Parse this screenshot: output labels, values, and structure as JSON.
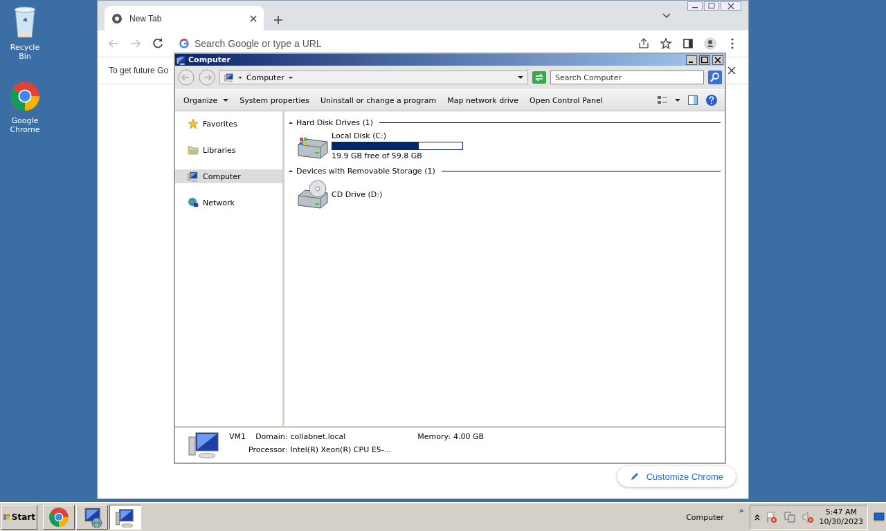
{
  "desktop_icons": [
    {
      "kind": "recycle",
      "label": "Recycle Bin"
    },
    {
      "kind": "chrome",
      "label": "Google Chrome"
    }
  ],
  "browser": {
    "tab_title": "New Tab",
    "address_placeholder": "Search Google or type a URL",
    "infobar_text": "To get future Go",
    "customize_button": "Customize Chrome"
  },
  "explorer": {
    "title": "Computer",
    "breadcrumb": "Computer",
    "search_placeholder": "Search Computer",
    "toolbar": [
      {
        "label": "Organize",
        "kind": "menu"
      },
      {
        "label": "System properties",
        "kind": "action"
      },
      {
        "label": "Uninstall or change a program",
        "kind": "action"
      },
      {
        "label": "Map network drive",
        "kind": "action"
      },
      {
        "label": "Open Control Panel",
        "kind": "action"
      }
    ],
    "nav": [
      {
        "label": "Favorites",
        "kind": "star",
        "selected": false
      },
      {
        "label": "Libraries",
        "kind": "folder",
        "selected": false
      },
      {
        "label": "Computer",
        "kind": "computer",
        "selected": true
      },
      {
        "label": "Network",
        "kind": "network",
        "selected": false
      }
    ],
    "groups": [
      {
        "title": "Hard Disk Drives (1)",
        "items": [
          {
            "kind": "disk",
            "name": "Local Disk (C:)",
            "level": 0.663,
            "detail": "19.9 GB free of 59.8 GB"
          }
        ]
      },
      {
        "title": "Devices with Removable Storage (1)",
        "items": [
          {
            "kind": "cd",
            "name": "CD Drive (D:)"
          }
        ]
      }
    ],
    "details": {
      "name": "VM1",
      "fields": [
        {
          "label": "Domain:",
          "value": "collabnet.local"
        },
        {
          "label": "Memory:",
          "value": "4.00 GB"
        },
        {
          "label": "Processor:",
          "value": "Intel(R) Xeon(R) CPU E5-..."
        }
      ]
    }
  },
  "taskbar": {
    "start": "Start",
    "buttons": [
      {
        "kind": "chrome",
        "selected": false
      },
      {
        "kind": "remote",
        "selected": false
      },
      {
        "kind": "computer",
        "selected": true
      }
    ],
    "toolbar_label": "Computer",
    "chevron": "»",
    "time": "5:47 AM",
    "date": "10/30/2023"
  }
}
